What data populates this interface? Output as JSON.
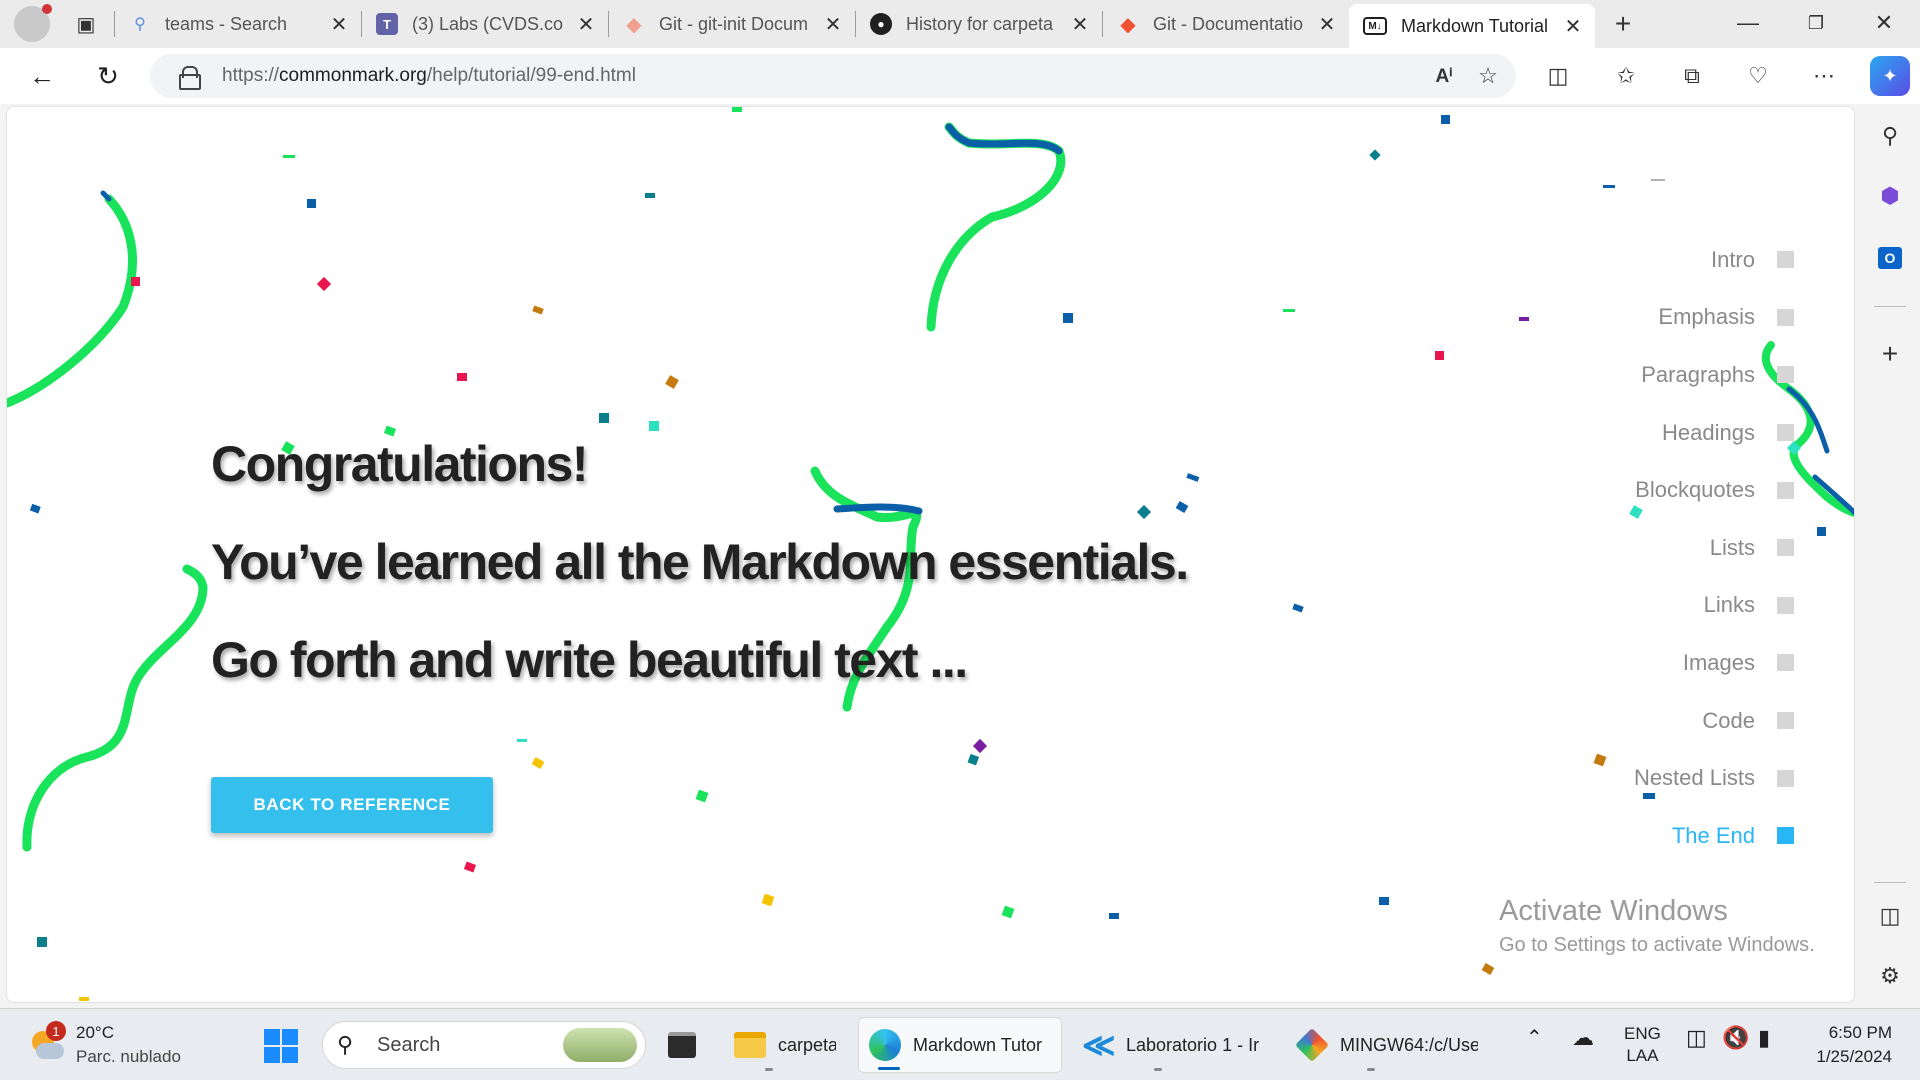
{
  "browser": {
    "tabs": [
      {
        "title": "teams - Search",
        "icon": "search-icon",
        "color": "#5b8fd9"
      },
      {
        "title": "(3) Labs (CVDS.co",
        "icon": "teams-icon",
        "color": "#6264a7"
      },
      {
        "title": "Git - git-init Docum",
        "icon": "git-icon",
        "color": "#f05133"
      },
      {
        "title": "History for carpeta",
        "icon": "github-icon",
        "color": "#1f1f1f"
      },
      {
        "title": "Git - Documentatio",
        "icon": "git-icon",
        "color": "#f05133"
      },
      {
        "title": "Markdown Tutorial",
        "icon": "markdown-icon",
        "color": "#1f1f1f",
        "active": true
      }
    ],
    "url_scheme": "https://",
    "url_host": "commonmark.org",
    "url_path": "/help/tutorial/99-end.html"
  },
  "page": {
    "headline_1": "Congratulations!",
    "headline_2": "You’ve learned all the Markdown essentials.",
    "headline_3": "Go forth and write beautiful text ...",
    "back_button": "BACK TO REFERENCE",
    "toc": [
      {
        "label": "Intro"
      },
      {
        "label": "Emphasis"
      },
      {
        "label": "Paragraphs"
      },
      {
        "label": "Headings"
      },
      {
        "label": "Blockquotes"
      },
      {
        "label": "Lists"
      },
      {
        "label": "Links"
      },
      {
        "label": "Images"
      },
      {
        "label": "Code"
      },
      {
        "label": "Nested Lists"
      },
      {
        "label": "The End",
        "current": true
      }
    ],
    "accent_color": "#29b6f6",
    "button_color": "#35bfec"
  },
  "watermark": {
    "title": "Activate Windows",
    "subtitle": "Go to Settings to activate Windows."
  },
  "taskbar": {
    "weather_temp": "20°C",
    "weather_desc": "Parc. nublado",
    "weather_badge": "1",
    "search_label": "Search",
    "apps": [
      {
        "label": "carpeta",
        "icon": "folder-icon"
      },
      {
        "label": "Markdown Tutor",
        "icon": "edge-icon",
        "active": true
      },
      {
        "label": "Laboratorio 1 - Ir",
        "icon": "vscode-icon"
      },
      {
        "label": "MINGW64:/c/Use",
        "icon": "git-bash-icon"
      }
    ],
    "lang_1": "ENG",
    "lang_2": "LAA",
    "time": "6:50 PM",
    "date": "1/25/2024"
  }
}
